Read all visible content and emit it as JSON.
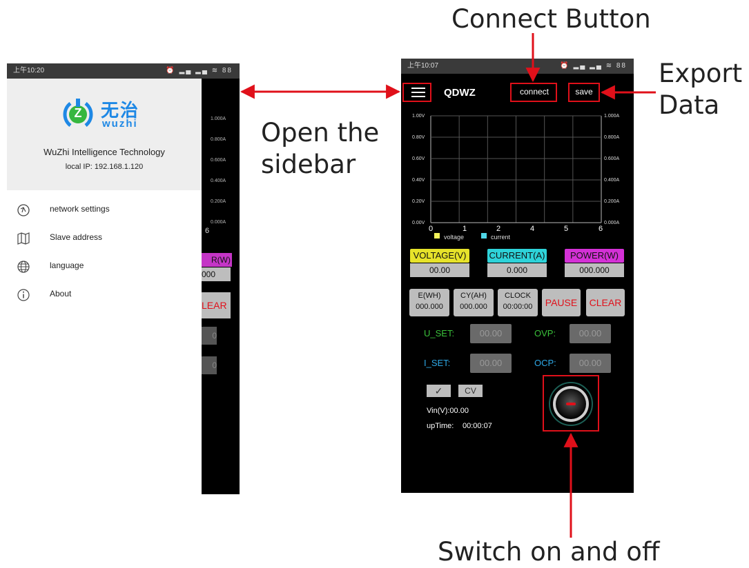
{
  "annotations": {
    "connect_button": "Connect Button",
    "export_data": "Export\nData",
    "open_sidebar": "Open the\nsidebar",
    "switch_on_off": "Switch on and off"
  },
  "sidebar_screen": {
    "status_time": "上午10:20",
    "status_icons": "⏰ ▂▄ ▂▄ ≋ 88",
    "logo": {
      "cn": "无治",
      "en": "wuzhi",
      "mark": "Z"
    },
    "company": "WuZhi Intelligence Technology",
    "local_ip": "local IP: 192.168.1.120",
    "menu": [
      {
        "label": "network settings",
        "icon": "network-icon"
      },
      {
        "label": "Slave address",
        "icon": "map-icon"
      },
      {
        "label": "language",
        "icon": "globe-icon"
      },
      {
        "label": "About",
        "icon": "info-icon"
      }
    ],
    "background_chart_ticks": [
      "1.000A",
      "0.800A",
      "0.600A",
      "0.400A",
      "0.200A",
      "0.000A"
    ],
    "background_x_last": "6",
    "background_power_label": "R(W)",
    "background_power_value": "000",
    "background_clear": "LEAR",
    "background_input_1": "0",
    "background_input_2": "0"
  },
  "main_screen": {
    "status_time": "上午10:07",
    "status_icons": "⏰ ▂▄ ▂▄ ≋ 88",
    "title": "QDWZ",
    "connect_label": "connect",
    "save_label": "save",
    "chart_data": {
      "type": "line",
      "x_ticks": [
        "0",
        "1",
        "2",
        "4",
        "5",
        "6"
      ],
      "y_left_ticks": [
        "1.00V",
        "0.80V",
        "0.60V",
        "0.40V",
        "0.20V",
        "0.00V"
      ],
      "y_right_ticks": [
        "1.000A",
        "0.800A",
        "0.600A",
        "0.400A",
        "0.200A",
        "0.000A"
      ],
      "ylim_left": [
        0,
        1
      ],
      "ylim_right": [
        0,
        1
      ],
      "series": [
        {
          "name": "voltage",
          "color": "#f3f35a",
          "values": []
        },
        {
          "name": "current",
          "color": "#4fd7e8",
          "values": []
        }
      ],
      "grid": true,
      "legend": "bottom"
    },
    "meters": [
      {
        "label": "VOLTAGE(V)",
        "value": "00.00",
        "color": "#e7e32a"
      },
      {
        "label": "CURRENT(A)",
        "value": "0.000",
        "color": "#2ed3d9"
      },
      {
        "label": "POWER(W)",
        "value": "000.000",
        "color": "#d431d6"
      }
    ],
    "stats": [
      {
        "label": "E(WH)",
        "value": "000.000"
      },
      {
        "label": "CY(AH)",
        "value": "000.000"
      },
      {
        "label": "CLOCK",
        "value": "00:00:00"
      }
    ],
    "pause_label": "PAUSE",
    "clear_label": "CLEAR",
    "u_set_label": "U_SET:",
    "u_set_value": "00.00",
    "ovp_label": "OVP:",
    "ovp_value": "00.00",
    "i_set_label": "I_SET:",
    "i_set_value": "00.00",
    "ocp_label": "OCP:",
    "ocp_value": "00.00",
    "check_label": "✓",
    "cv_label": "CV",
    "vin": "Vin(V):00.00",
    "uptime_label": "upTime:",
    "uptime_value": "00:00:07"
  }
}
